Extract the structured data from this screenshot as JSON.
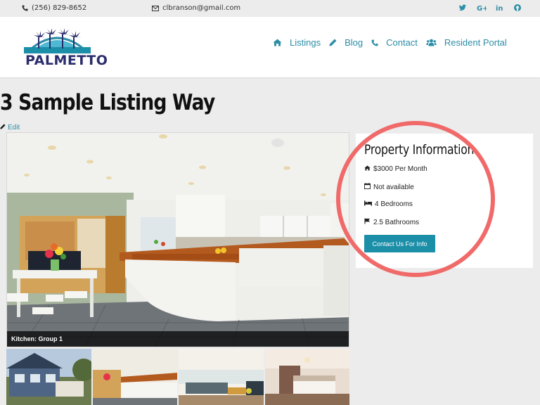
{
  "topbar": {
    "phone": "(256) 829-8652",
    "email": "clbranson@gmail.com",
    "social": [
      "twitter-icon",
      "google-plus-icon",
      "linkedin-icon",
      "github-icon"
    ]
  },
  "header": {
    "logo_text": "PALMETTO",
    "nav": [
      {
        "label": "Listings",
        "icon": "home-icon"
      },
      {
        "label": "Blog",
        "icon": "pencil-icon"
      },
      {
        "label": "Contact",
        "icon": "phone-icon"
      },
      {
        "label": "Resident Portal",
        "icon": "users-icon"
      }
    ]
  },
  "page": {
    "title": "3 Sample Listing Way",
    "edit_label": "Edit"
  },
  "gallery": {
    "caption": "Kitchen: Group 1",
    "thumbnails": [
      "house-exterior",
      "kitchen",
      "living-room",
      "bedroom"
    ]
  },
  "property": {
    "heading": "Property Information",
    "price": "$3000 Per Month",
    "availability": "Not available",
    "bedrooms": "4 Bedrooms",
    "bathrooms": "2.5 Bathrooms",
    "cta": "Contact Us For Info"
  },
  "colors": {
    "accent": "#1b8ea8",
    "link": "#2d8ea7",
    "annotation": "#f06a6a",
    "logo_navy": "#2a2c6c"
  }
}
